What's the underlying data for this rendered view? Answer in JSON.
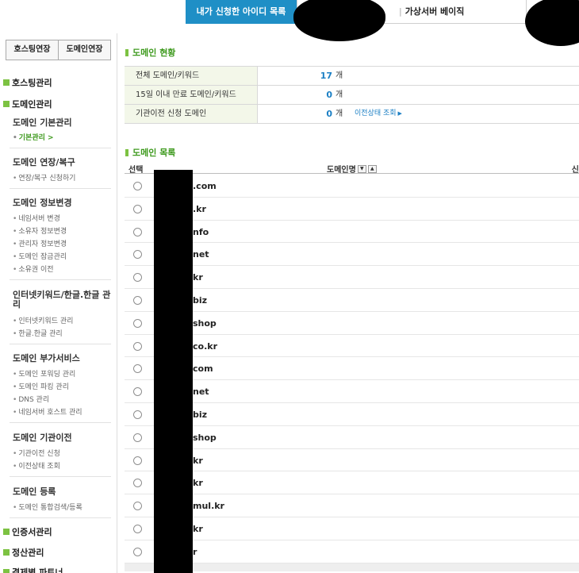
{
  "topbar": {
    "my_id_tab": "내가 신청한 아이디 목록",
    "vserver_sep": "|",
    "vserver_tab": "가상서버 베이직"
  },
  "sidebar": {
    "toggle": [
      "호스팅연장",
      "도메인연장"
    ],
    "categories": {
      "hosting": "호스팅관리",
      "domain": "도메인관리",
      "cert": "인증서관리",
      "billing": "정산관리",
      "partner": "결제별 파트너"
    },
    "groups": [
      {
        "title": "도메인 기본관리",
        "items": [
          "기본관리 >"
        ]
      },
      {
        "title": "도메인 연장/복구",
        "items": [
          "연장/복구 신청하기"
        ]
      },
      {
        "title": "도메인 정보변경",
        "items": [
          "네임서버 변경",
          "소유자 정보변경",
          "관리자 정보변경",
          "도메인 잠금관리",
          "소유권 이전"
        ]
      },
      {
        "title": "인터넷키워드/한글.한글 관리",
        "items": [
          "인터넷키워드 관리",
          "한글.한글 관리"
        ]
      },
      {
        "title": "도메인 부가서비스",
        "items": [
          "도메인 포워딩 관리",
          "도메인 파킹 관리",
          "DNS 관리",
          "네임서버 호스트 관리"
        ]
      },
      {
        "title": "도메인 기관이전",
        "items": [
          "기관이전 신청",
          "이전상태 조회"
        ]
      },
      {
        "title": "도메인 등록",
        "items": [
          "도메인 통합검색/등록"
        ]
      }
    ]
  },
  "status": {
    "title": "도메인 현황",
    "rows": [
      {
        "label": "전체 도메인/키워드",
        "value": "17",
        "unit": "개",
        "link": ""
      },
      {
        "label": "15일 이내 만료 도메인/키워드",
        "value": "0",
        "unit": "개",
        "link": ""
      },
      {
        "label": "기관이전 신청 도메인",
        "value": "0",
        "unit": "개",
        "link": "이전상태 조회"
      }
    ]
  },
  "domain_list": {
    "title": "도메인 목록",
    "col_select": "선택",
    "col_domain": "도메인명",
    "col_right": "신",
    "domains": [
      ".com",
      ".kr",
      "nfo",
      "net",
      "kr",
      "biz",
      "shop",
      "co.kr",
      "com",
      "net",
      "biz",
      "shop",
      "kr",
      "kr",
      "mul.kr",
      "kr",
      "r"
    ]
  }
}
